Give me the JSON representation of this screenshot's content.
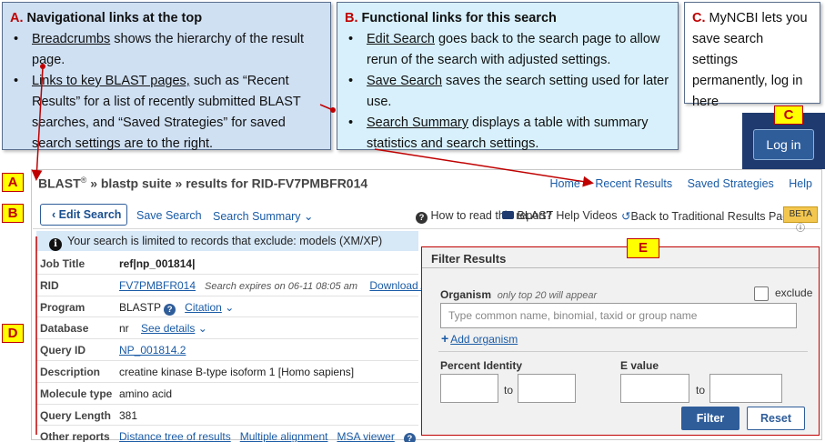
{
  "callout_a": {
    "letter": "A",
    "heading": "Navigational links at the top",
    "b1_term": "Breadcrumbs",
    "b1_rest": " shows the hierarchy of the result page.",
    "b2_term": "Links to key BLAST pages,",
    "b2_rest": " such as “Recent Results” for a list of recently submitted BLAST searches, and “Saved Strategies” for saved search settings are to the right."
  },
  "callout_b": {
    "letter": "B",
    "heading": "Functional links for this search",
    "b1_term": "Edit Search",
    "b1_rest": " goes back to the search page to allow rerun of the search with adjusted settings.",
    "b2_term": "Save Search",
    "b2_rest": " saves the search setting used for later use.",
    "b3_term": "Search Summary",
    "b3_rest": " displays a table with summary statistics and search settings."
  },
  "callout_c": {
    "letter": "C",
    "text": "MyNCBI lets you save search settings permanently, log in here"
  },
  "markers": {
    "a": "A",
    "b": "B",
    "c": "C",
    "d": "D",
    "e": "E"
  },
  "login": {
    "label": "Log in"
  },
  "breadcrumb": {
    "blast": "BLAST",
    "reg": "®",
    "rest": "» blastp suite » results for RID-FV7PMBFR014"
  },
  "top_links": [
    "Home",
    "Recent Results",
    "Saved Strategies",
    "Help"
  ],
  "toolbar": {
    "edit_search": "Edit Search",
    "save_search": "Save Search",
    "search_summary": "Search Summary",
    "how_to_read": "How to read this report?",
    "help_videos": "BLAST Help Videos",
    "back_traditional": "Back to Traditional Results Page",
    "beta": "BETA"
  },
  "notice": "Your search is limited to records that exclude: models (XM/XP)",
  "summary": {
    "job_title_label": "Job Title",
    "job_title": "ref|np_001814|",
    "rid_label": "RID",
    "rid": "FV7PMBFR014",
    "rid_expiry": "Search expires on 06-11 08:05 am",
    "download_all": "Download All",
    "program_label": "Program",
    "program": "BLASTP",
    "citation": "Citation",
    "database_label": "Database",
    "database": "nr",
    "see_details": "See details",
    "query_id_label": "Query ID",
    "query_id": "NP_001814.2",
    "description_label": "Description",
    "description": "creatine kinase B-type isoform 1 [Homo sapiens]",
    "molecule_label": "Molecule type",
    "molecule": "amino acid",
    "query_length_label": "Query Length",
    "query_length": "381",
    "other_reports_label": "Other reports",
    "distance_tree": "Distance tree of results",
    "multiple_alignment": "Multiple alignment",
    "msa_viewer": "MSA viewer"
  },
  "filter": {
    "title": "Filter Results",
    "organism_label": "Organism",
    "organism_hint": "only top 20 will appear",
    "exclude": "exclude",
    "organism_placeholder": "Type common name, binomial, taxid or group name",
    "add_organism": "Add organism",
    "percent_identity": "Percent Identity",
    "e_value": "E value",
    "to": "to",
    "filter_button": "Filter",
    "reset_button": "Reset"
  },
  "colors": {
    "callout_a_bg": "#cfe0f3",
    "callout_b_bg": "#d7f0fb",
    "marker_bg": "#ffff00",
    "marker_text": "#c00000",
    "arrow": "#c00000",
    "login_bar": "#1f3a6e",
    "link": "#1a5ba6"
  }
}
